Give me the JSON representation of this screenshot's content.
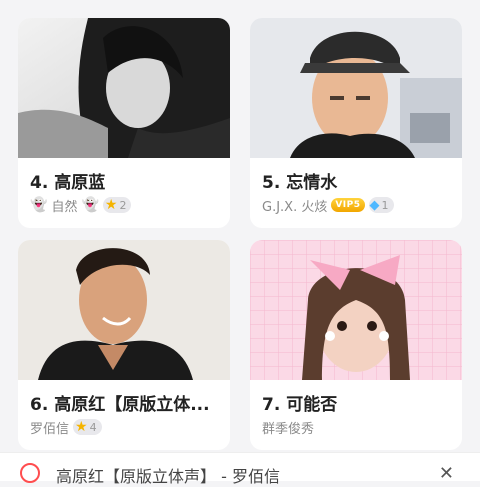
{
  "cards": [
    {
      "title": "4. 高原蓝",
      "author": "自然",
      "author_emoji": "👻",
      "badge_count": "2"
    },
    {
      "title": "5. 忘情水",
      "author": "G.J.X. 火烗",
      "vip": "VIP5",
      "gem_count": "1"
    },
    {
      "title": "6. 高原红【原版立体...",
      "author": "罗佰信",
      "badge_count": "4"
    },
    {
      "title": "7. 可能否",
      "author": "群季俊秀"
    }
  ],
  "now_playing": {
    "text": "高原红【原版立体声】 - 罗佰信"
  },
  "icons": {
    "star": "star-icon",
    "gem": "diamond-icon",
    "close": "close-icon"
  },
  "colors": {
    "vip": "#f5b400",
    "gem": "#4fb8ff",
    "accent": "#ff4d4f"
  }
}
